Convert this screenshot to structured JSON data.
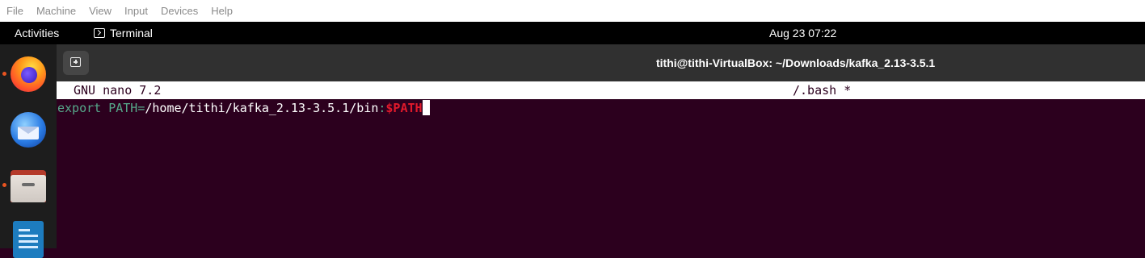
{
  "vbox_menu": [
    "File",
    "Machine",
    "View",
    "Input",
    "Devices",
    "Help"
  ],
  "topbar": {
    "activities": "Activities",
    "app_name": "Terminal",
    "clock": "Aug 23  07:22"
  },
  "dock": {
    "apps": [
      "firefox",
      "thunderbird",
      "files",
      "libreoffice-writer"
    ]
  },
  "window": {
    "title": "tithi@tithi-VirtualBox: ~/Downloads/kafka_2.13-3.5.1"
  },
  "nano": {
    "version": "GNU nano 7.2",
    "filename": "/.bash *",
    "line": {
      "keyword": "export",
      "var_name": " PATH",
      "equals": "=",
      "path": "/home/tithi/kafka_2.13-3.5.1/bin",
      "colon": ":",
      "var_ref": "$PATH"
    }
  },
  "colors": {
    "terminal_bg": "#2c001e",
    "keyword": "#56a88a",
    "variable": "#e0192b",
    "accent": "#e95420"
  }
}
